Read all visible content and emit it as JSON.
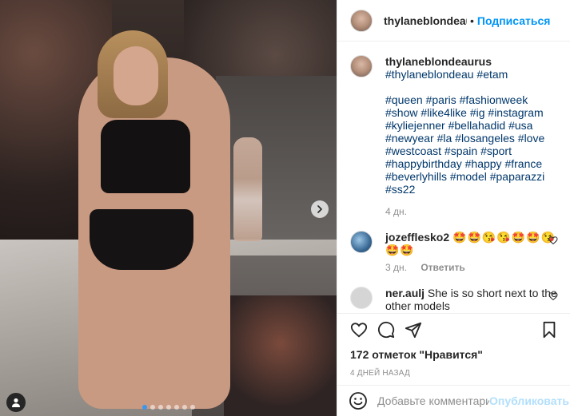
{
  "post": {
    "username": "thylaneblondeauru",
    "header_separator": "•",
    "follow_label": "Подписаться",
    "image_alt": "runway photo",
    "carousel": {
      "count": 7,
      "active_index": 0
    }
  },
  "caption": {
    "username": "thylaneblondeaurus",
    "hashtags_line1": "#thylaneblondeau #etam",
    "hashtags_line2": "#queen #paris #fashionweek #show #like4like #ig #instagram #kyliejenner #bellahadid #usa #newyear #la #losangeles #love #westcoast #spain #sport #happybirthday #happy #france #beverlyhills #model #paparazzi #ss22",
    "time": "4 дн."
  },
  "comments": [
    {
      "username": "jozefflesko2",
      "text": "🤩🤩😘😘🤩🤩😘🤩🤩",
      "time": "3 дн.",
      "reply_label": "Ответить"
    },
    {
      "username": "ner.aulj",
      "text": "She is so short next to the other models"
    }
  ],
  "actions": {
    "like_icon": "heart-icon",
    "comment_icon": "comment-icon",
    "share_icon": "paper-plane-icon",
    "save_icon": "bookmark-icon"
  },
  "likes_text": "172 отметок \"Нравится\"",
  "date_text": "4 дней назад",
  "add_comment": {
    "placeholder": "Добавьте комментарий...",
    "post_label": "Опубликовать"
  },
  "colors": {
    "link_blue": "#0095f6",
    "hashtag": "#00376b",
    "muted": "#8e8e8e",
    "carousel_active_dot": "#3897f0"
  }
}
